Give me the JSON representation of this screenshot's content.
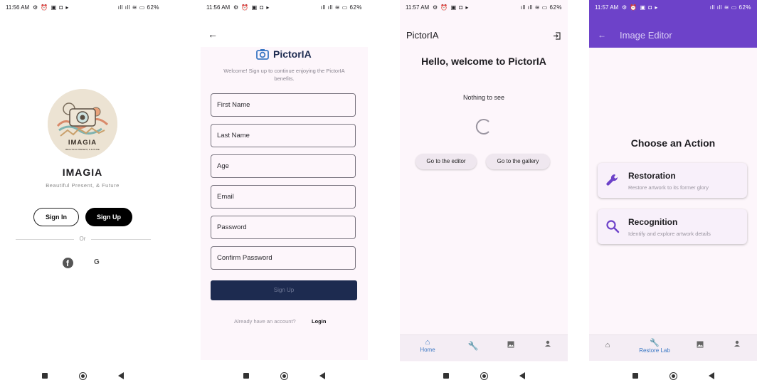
{
  "status": {
    "p1_time": "11:56 AM",
    "p2_time": "11:56 AM",
    "p3_time": "11:57 AM",
    "p4_time": "11:57 AM",
    "icons": "⚙ ⏰ ▣ ◘ ▸",
    "right": "ıll ıll ≋ ▭ 62%"
  },
  "welcome_screen": {
    "logo_text": "IMAGIA",
    "logo_subtext": "BEAUTIFUL PRESENT, & FUTURE",
    "title": "IMAGIA",
    "subtitle": "Beautiful Present, & Future",
    "sign_in": "Sign In",
    "sign_up": "Sign Up",
    "divider_label": "Or",
    "google_label": "G"
  },
  "signup_screen": {
    "back": "←",
    "brand": "PictorIA",
    "tagline": "Welcome! Sign up to continue enjoying the PictorIA benefits.",
    "fields": {
      "first_name": "First Name",
      "last_name": "Last Name",
      "age": "Age",
      "email": "Email",
      "password": "Password",
      "confirm_password": "Confirm Password"
    },
    "submit": "Sign Up",
    "already": "Already have an account?",
    "login": "Login"
  },
  "home_screen": {
    "app_title": "PictorIA",
    "heading": "Hello, welcome to PictorIA",
    "empty_text": "Nothing to see",
    "go_editor": "Go to the editor",
    "go_gallery": "Go to the gallery",
    "nav_home": "Home"
  },
  "editor_screen": {
    "title": "Image Editor",
    "heading": "Choose an Action",
    "restoration": {
      "title": "Restoration",
      "subtitle": "Restore artwork to its former glory"
    },
    "recognition": {
      "title": "Recognition",
      "subtitle": "Identify and explore artwork details"
    },
    "nav_restore": "Restore Lab"
  },
  "colors": {
    "purple": "#6d42c9",
    "navy": "#1d2b50",
    "blue_active": "#3b78c4"
  }
}
